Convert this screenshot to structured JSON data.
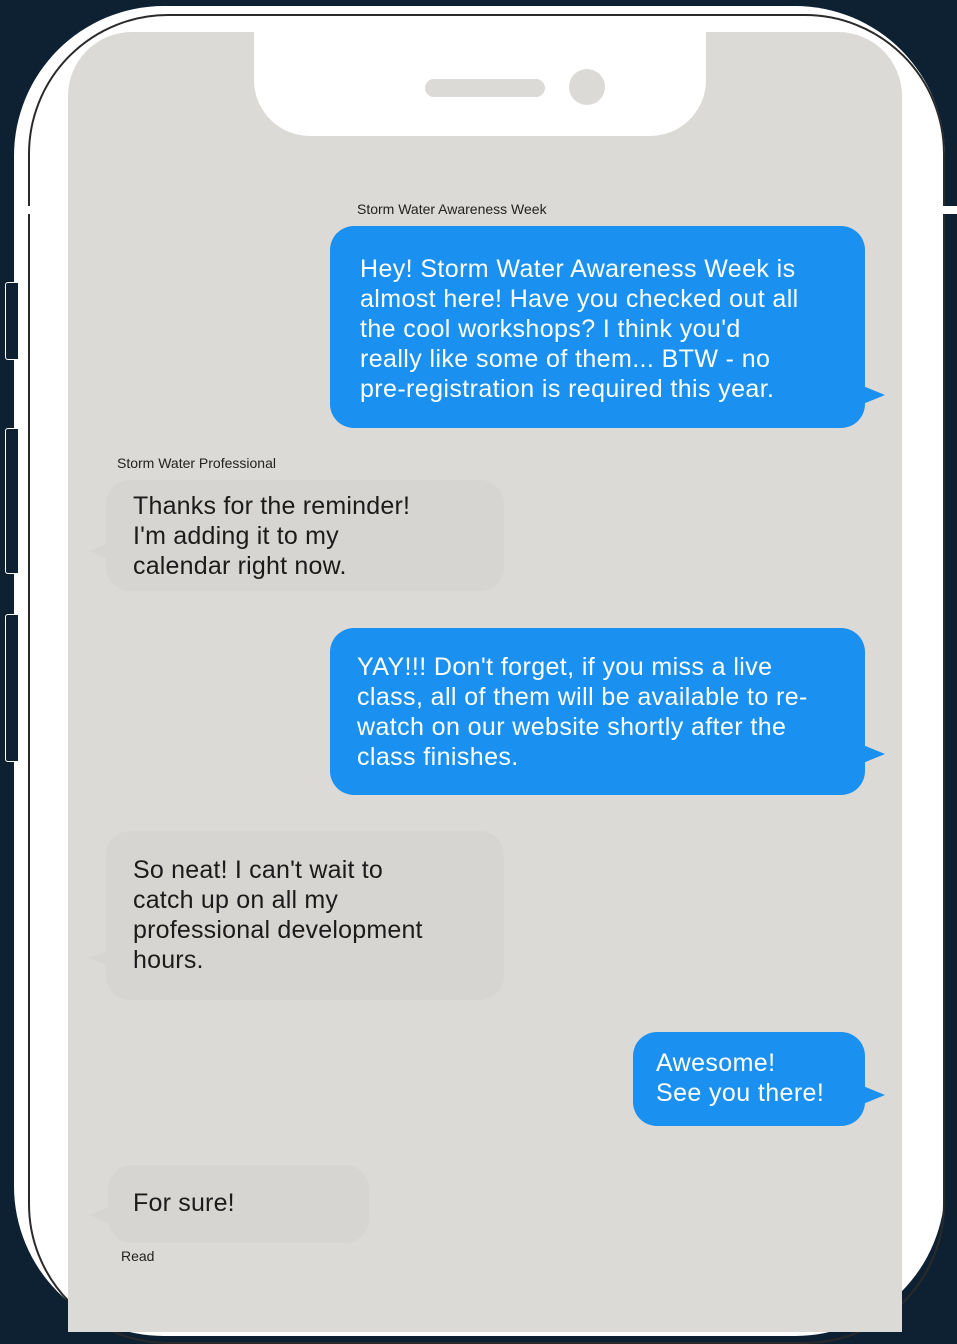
{
  "colors": {
    "background": "#0d2133",
    "phone_frame": "#ffffff",
    "screen": "#dbdad6",
    "sent_bubble": "#1a91f0",
    "received_bubble": "#d6d5d1"
  },
  "conversation": {
    "messages": [
      {
        "direction": "sent",
        "sender_label": "Storm Water Awareness Week",
        "text": "Hey!  Storm Water Awareness Week is\nalmost here!  Have you checked out all\nthe cool workshops?  I think you'd\nreally like some of them...  BTW - no\npre-registration is required this year."
      },
      {
        "direction": "received",
        "sender_label": "Storm Water Professional",
        "text": "Thanks for the reminder!\n I'm adding it to my\ncalendar right now."
      },
      {
        "direction": "sent",
        "text": "YAY!!!  Don't forget, if you miss a live\nclass, all of them will be available to re-\nwatch on our website shortly after the\nclass finishes."
      },
      {
        "direction": "received",
        "text": "So neat! I can't wait to\ncatch up on all my\nprofessional development\nhours."
      },
      {
        "direction": "sent",
        "text": "Awesome!\nSee you there!"
      },
      {
        "direction": "received",
        "text": "For sure!"
      }
    ],
    "read_receipt": "Read"
  }
}
